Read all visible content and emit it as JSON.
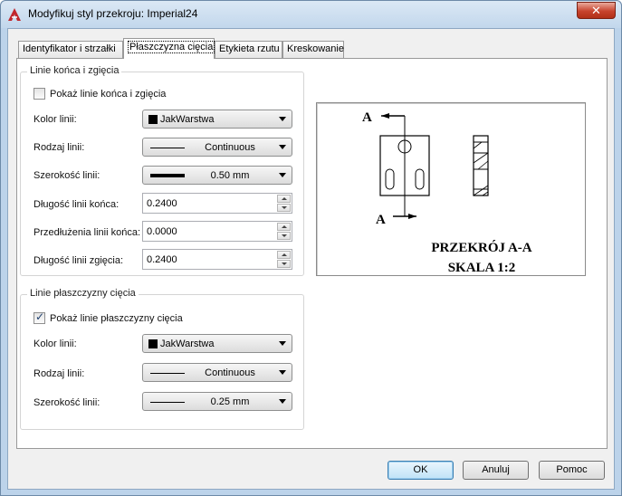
{
  "window": {
    "title": "Modyfikuj styl przekroju: Imperial24",
    "close_glyph": "✕"
  },
  "tabs": [
    {
      "label": "Identyfikator i strzałki"
    },
    {
      "label": "Płaszczyzna cięcia"
    },
    {
      "label": "Etykieta rzutu"
    },
    {
      "label": "Kreskowanie"
    }
  ],
  "end_lines_group": {
    "title": "Linie końca i zgięcia",
    "show_checkbox_label": "Pokaż linie końca i zgięcia",
    "show_checked": false,
    "color_label": "Kolor linii:",
    "color_value": "JakWarstwa",
    "linetype_label": "Rodzaj linii:",
    "linetype_value": "Continuous",
    "lineweight_label": "Szerokość linii:",
    "lineweight_value": "0.50 mm",
    "end_length_label": "Długość linii końca:",
    "end_length_value": "0.2400",
    "extension_label": "Przedłużenia linii końca:",
    "extension_value": "0.0000",
    "jog_length_label": "Długość linii zgięcia:",
    "jog_length_value": "0.2400"
  },
  "plane_lines_group": {
    "title": "Linie płaszczyzny cięcia",
    "show_checkbox_label": "Pokaż linie płaszczyzny cięcia",
    "show_checked": true,
    "color_label": "Kolor linii:",
    "color_value": "JakWarstwa",
    "linetype_label": "Rodzaj linii:",
    "linetype_value": "Continuous",
    "lineweight_label": "Szerokość linii:",
    "lineweight_value": "0.25 mm"
  },
  "preview": {
    "marker_top": "A",
    "marker_bottom": "A",
    "caption_line1": "PRZEKRÓJ A-A",
    "caption_line2": "SKALA 1:2"
  },
  "buttons": {
    "ok": "OK",
    "cancel": "Anuluj",
    "help": "Pomoc"
  },
  "colors": {
    "title_bar": "#c2d7ec",
    "close_button": "#c7432d",
    "app_icon": "#c1272d"
  }
}
